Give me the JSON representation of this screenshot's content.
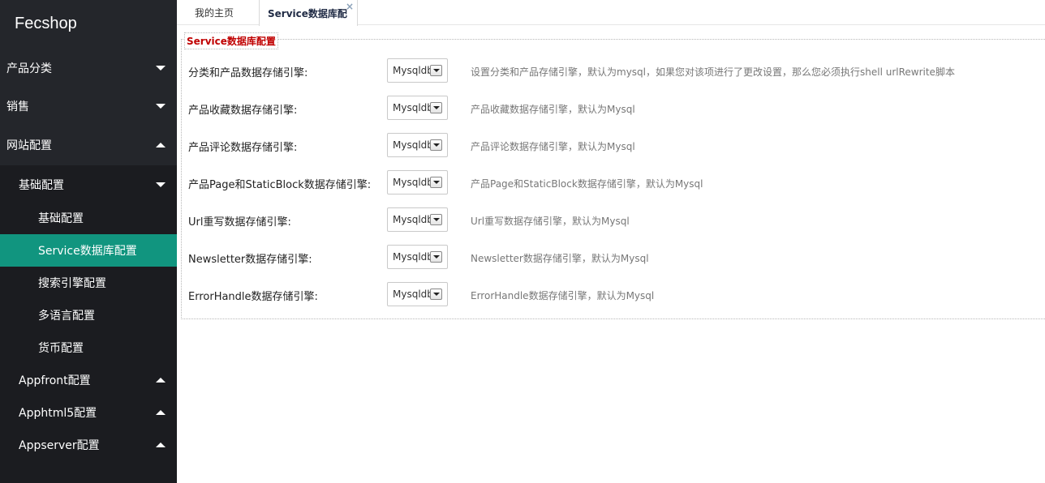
{
  "sidebar": {
    "brand": "Fecshop",
    "menu": [
      {
        "label": "产品分类",
        "state": "collapsed"
      },
      {
        "label": "销售",
        "state": "collapsed"
      },
      {
        "label": "网站配置",
        "state": "expanded"
      }
    ],
    "sub_groups": [
      {
        "label": "基础配置",
        "state": "expanded"
      },
      {
        "label": "Appfront配置",
        "state": "collapsed"
      },
      {
        "label": "Apphtml5配置",
        "state": "collapsed"
      },
      {
        "label": "Appserver配置",
        "state": "collapsed"
      }
    ],
    "sub_items": [
      {
        "label": "基础配置"
      },
      {
        "label": "Service数据库配置",
        "active": true
      },
      {
        "label": "搜索引擎配置"
      },
      {
        "label": "多语言配置"
      },
      {
        "label": "货币配置"
      }
    ],
    "colors": {
      "background": "#24262b",
      "active": "#11957f"
    }
  },
  "tabs": [
    {
      "label": "我的主页"
    },
    {
      "label": "Service数据库配",
      "close": "×"
    }
  ],
  "form": {
    "legend": "Service数据库配置",
    "rows": [
      {
        "label": "分类和产品数据存储引擎:",
        "value": "Mysqldb",
        "hint": "设置分类和产品存储引擎，默认为mysql，如果您对该项进行了更改设置，那么您必须执行shell urlRewrite脚本"
      },
      {
        "label": "产品收藏数据存储引擎:",
        "value": "Mysqldb",
        "hint": "产品收藏数据存储引擎，默认为Mysql"
      },
      {
        "label": "产品评论数据存储引擎:",
        "value": "Mysqldb",
        "hint": "产品评论数据存储引擎，默认为Mysql"
      },
      {
        "label": "产品Page和StaticBlock数据存储引擎:",
        "value": "Mysqldb",
        "hint": "产品Page和StaticBlock数据存储引擎，默认为Mysql"
      },
      {
        "label": "Url重写数据存储引擎:",
        "value": "Mysqldb",
        "hint": "Url重写数据存储引擎，默认为Mysql"
      },
      {
        "label": "Newsletter数据存储引擎:",
        "value": "Mysqldb",
        "hint": "Newsletter数据存储引擎，默认为Mysql"
      },
      {
        "label": "ErrorHandle数据存储引擎:",
        "value": "Mysqldb",
        "hint": "ErrorHandle数据存储引擎，默认为Mysql"
      }
    ],
    "colors": {
      "legend": "#c00000"
    }
  }
}
